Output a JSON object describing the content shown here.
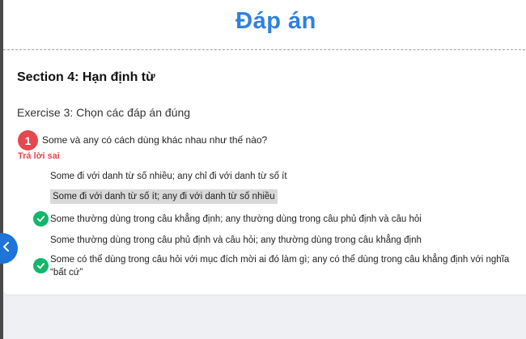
{
  "header": {
    "title": "Đáp án"
  },
  "section": {
    "title": "Section 4: Hạn định từ"
  },
  "exercise": {
    "title": "Exercise 3: Chọn các đáp án đúng"
  },
  "question": {
    "number": "1",
    "text": "Some và any có cách dùng khác nhau như thế nào?",
    "result_label": "Trả lời sai",
    "options": [
      {
        "text": "Some đi với danh từ số nhiều; any chỉ đi với danh từ số ít",
        "correct": false,
        "selected": false
      },
      {
        "text": "Some đi với danh từ số ít; any đi với danh từ số nhiều",
        "correct": false,
        "selected": true
      },
      {
        "text": "Some thường dùng trong câu khẳng định; any thường dùng trong câu phủ định và câu hỏi",
        "correct": true,
        "selected": false
      },
      {
        "text": "Some thường dùng trong câu phủ định và câu hỏi; any thường dùng trong câu khẳng định",
        "correct": false,
        "selected": false
      },
      {
        "text": "Some có thể dùng trong câu hỏi với mục đích mời ai đó làm gì; any có thể dùng trong câu khẳng định với nghĩa “bất cứ”",
        "correct": true,
        "selected": false
      }
    ]
  },
  "colors": {
    "accent": "#2f80e0",
    "wrong": "#e5484d",
    "correct": "#12b76a",
    "nav": "#1e74d8"
  },
  "icons": {
    "correct": "check-circle-icon",
    "nav": "chevron-left-icon"
  }
}
